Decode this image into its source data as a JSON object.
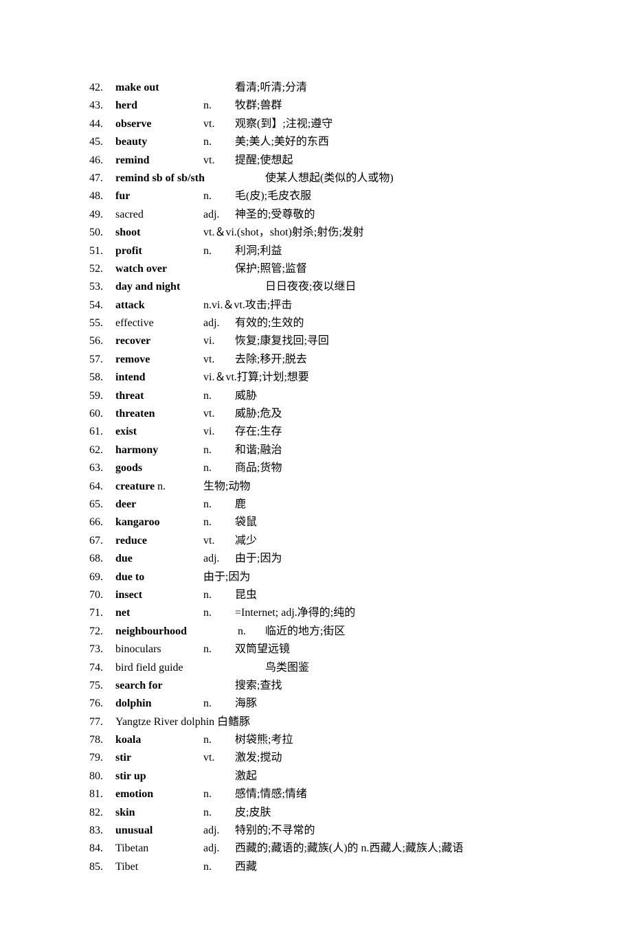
{
  "entries": [
    {
      "num": "42.",
      "word": "make out",
      "bold": true,
      "pos": "",
      "def": "看清;听清;分清"
    },
    {
      "num": "43.",
      "word": "herd",
      "bold": true,
      "pos": "n.",
      "def": "牧群;兽群"
    },
    {
      "num": "44.",
      "word": "observe",
      "bold": true,
      "pos": "vt.",
      "def": "观察(到】;注视;遵守"
    },
    {
      "num": "45.",
      "word": "beauty",
      "bold": true,
      "pos": "n.",
      "def": "美;美人;美好的东西"
    },
    {
      "num": "46.",
      "word": "remind",
      "bold": true,
      "pos": "vt.",
      "def": "提醒;使想起"
    },
    {
      "num": "47.",
      "word": "remind sb of sb/sth",
      "bold": true,
      "pos": "",
      "def": "使某人想起(类似的人或物)",
      "wideWord": true
    },
    {
      "num": "48.",
      "word": "fur",
      "bold": true,
      "pos": "n.",
      "def": "毛(皮);毛皮衣服"
    },
    {
      "num": "49.",
      "word": "sacred",
      "bold": false,
      "pos": "adj.",
      "def": "神圣的;受尊敬的"
    },
    {
      "num": "50.",
      "word": "shoot",
      "bold": true,
      "pos": "",
      "def": "vt.＆vi.(shot，shot)射杀;射伤;发射",
      "noPos": true
    },
    {
      "num": "51.",
      "word": "profit",
      "bold": true,
      "pos": "n.",
      "def": "利洞;利益"
    },
    {
      "num": "52.",
      "word": "watch over",
      "bold": true,
      "pos": "",
      "def": "保护;照管;监督"
    },
    {
      "num": "53.",
      "word": "day and night",
      "bold": true,
      "pos": "",
      "def": "日日夜夜;夜以继日",
      "wideWord": true
    },
    {
      "num": "54.",
      "word": "attack",
      "bold": true,
      "pos": "",
      "def": "n.vi.＆vt.攻击;抨击",
      "noPos": true
    },
    {
      "num": "55.",
      "word": "effective",
      "bold": false,
      "pos": "adj.",
      "def": "有效的;生效的"
    },
    {
      "num": "56.",
      "word": "recover",
      "bold": true,
      "pos": "vi.",
      "def": "恢复;康复找回;寻回"
    },
    {
      "num": "57.",
      "word": "remove",
      "bold": true,
      "pos": "vt.",
      "def": "去除;移开;脱去"
    },
    {
      "num": "58.",
      "word": "intend",
      "bold": true,
      "pos": "",
      "def": "vi.＆vt.打算;计划;想要",
      "noPos": true
    },
    {
      "num": "59.",
      "word": "threat",
      "bold": true,
      "pos": "n.",
      "def": "威胁"
    },
    {
      "num": "60.",
      "word": "threaten",
      "bold": true,
      "pos": "vt.",
      "def": "威胁;危及"
    },
    {
      "num": "61.",
      "word": "exist",
      "bold": true,
      "pos": "vi.",
      "def": "存在;生存"
    },
    {
      "num": "62.",
      "word": "harmony",
      "bold": true,
      "pos": "n.",
      "def": "和谐;融治"
    },
    {
      "num": "63.",
      "word": "goods",
      "bold": true,
      "pos": "n.",
      "def": "商品;货物"
    },
    {
      "num": "64.",
      "word": "creature",
      "bold": true,
      "pos": "n.",
      "def": "生物;动物",
      "inlinePos": true
    },
    {
      "num": "65.",
      "word": "deer",
      "bold": true,
      "pos": "n.",
      "def": "鹿"
    },
    {
      "num": "66.",
      "word": "kangaroo",
      "bold": true,
      "pos": "n.",
      "def": "袋鼠"
    },
    {
      "num": "67.",
      "word": "reduce",
      "bold": true,
      "pos": "vt.",
      "def": "减少"
    },
    {
      "num": "68.",
      "word": "due",
      "bold": true,
      "pos": "adj.",
      "def": "由于;因为"
    },
    {
      "num": "69.",
      "word": "due to",
      "bold": true,
      "pos": "",
      "def": "由于;因为",
      "noPos": true
    },
    {
      "num": "70.",
      "word": "insect",
      "bold": true,
      "pos": "n.",
      "def": "昆虫"
    },
    {
      "num": "71.",
      "word": "net",
      "bold": true,
      "pos": "n.",
      "def": "=Internet; adj.净得的;纯的"
    },
    {
      "num": "72.",
      "word": "neighbourhood",
      "bold": true,
      "pos": "n.",
      "def": "临近的地方;街区",
      "wideWord": true
    },
    {
      "num": "73.",
      "word": "binoculars",
      "bold": false,
      "pos": "n.",
      "def": "双筒望远镜"
    },
    {
      "num": "74.",
      "word": "bird field guide",
      "bold": false,
      "pos": "",
      "def": "鸟类图鉴",
      "wideWord": true
    },
    {
      "num": "75.",
      "word": "search for",
      "bold": true,
      "pos": "",
      "def": "搜索;查找"
    },
    {
      "num": "76.",
      "word": "dolphin",
      "bold": true,
      "pos": "n.",
      "def": "海豚"
    },
    {
      "num": "77.",
      "word": "Yangtze River dolphin",
      "bold": false,
      "pos": "",
      "def": "白鳍豚",
      "fullLine": true
    },
    {
      "num": "78.",
      "word": "koala",
      "bold": true,
      "pos": "n.",
      "def": "树袋熊;考拉"
    },
    {
      "num": "79.",
      "word": "stir",
      "bold": true,
      "pos": "vt.",
      "def": "激发;搅动"
    },
    {
      "num": "80.",
      "word": "stir up",
      "bold": true,
      "pos": "",
      "def": "激起"
    },
    {
      "num": "81.",
      "word": "emotion",
      "bold": true,
      "pos": "n.",
      "def": "感情;情感;情绪"
    },
    {
      "num": "82.",
      "word": "skin",
      "bold": true,
      "pos": "n.",
      "def": "皮;皮肤"
    },
    {
      "num": "83.",
      "word": "unusual",
      "bold": true,
      "pos": "adj.",
      "def": "特别的;不寻常的"
    },
    {
      "num": "84.",
      "word": "Tibetan",
      "bold": false,
      "pos": "adj.",
      "def": "西藏的;藏语的;藏族(人)的 n.西藏人;藏族人;藏语"
    },
    {
      "num": "85.",
      "word": "Tibet",
      "bold": false,
      "pos": "n.",
      "def": "西藏"
    }
  ]
}
